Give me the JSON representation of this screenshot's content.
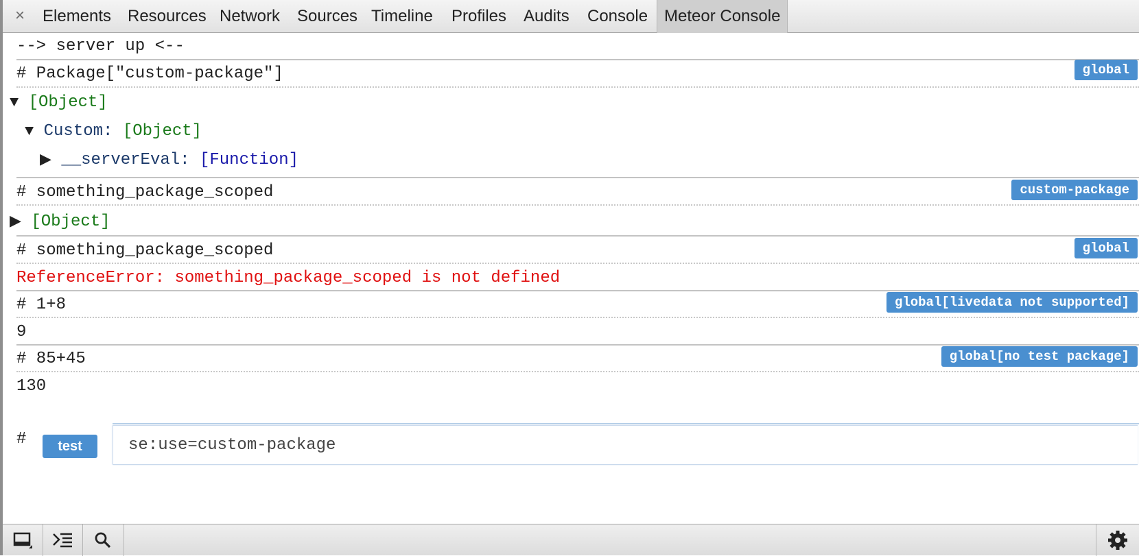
{
  "tabs": {
    "close_icon": "×",
    "items": [
      {
        "label": "Elements"
      },
      {
        "label": "Resources"
      },
      {
        "label": "Network"
      },
      {
        "label": "Sources"
      },
      {
        "label": "Timeline"
      },
      {
        "label": "Profiles"
      },
      {
        "label": "Audits"
      },
      {
        "label": "Console"
      },
      {
        "label": "Meteor Console"
      }
    ],
    "active": "Meteor Console"
  },
  "console": {
    "server_status": "--> server up <--",
    "entries": [
      {
        "command": "# Package[\"custom-package\"]",
        "scope": "global",
        "tree": [
          {
            "toggle": "▼",
            "value": "[Object]"
          },
          {
            "toggle": "▼",
            "key": "Custom:",
            "value": "[Object]"
          },
          {
            "toggle": "▶",
            "key": "__serverEval:",
            "value": "[Function]"
          }
        ]
      },
      {
        "command": "# something_package_scoped",
        "scope": "custom-package",
        "tree": [
          {
            "toggle": "▶",
            "value": "[Object]"
          }
        ]
      },
      {
        "command": "# something_package_scoped",
        "scope": "global",
        "error": "ReferenceError: something_package_scoped is not defined"
      },
      {
        "command": "# 1+8",
        "scope": "global[livedata not supported]",
        "result": "9"
      },
      {
        "command": "# 85+45",
        "scope": "global[no test package]",
        "result": "130"
      }
    ],
    "prompt": {
      "hash": "#",
      "scope_button": "test",
      "input_value": "se:use=custom-package"
    }
  },
  "colors": {
    "badge": "#4a8fd0",
    "object": "#1a7a1a",
    "function": "#1a1aaa",
    "key": "#1c3a6a",
    "error": "#e01010"
  },
  "statusbar": {
    "icons": [
      "dock-icon",
      "show-drawer-icon",
      "search-icon",
      "gear-icon"
    ]
  }
}
